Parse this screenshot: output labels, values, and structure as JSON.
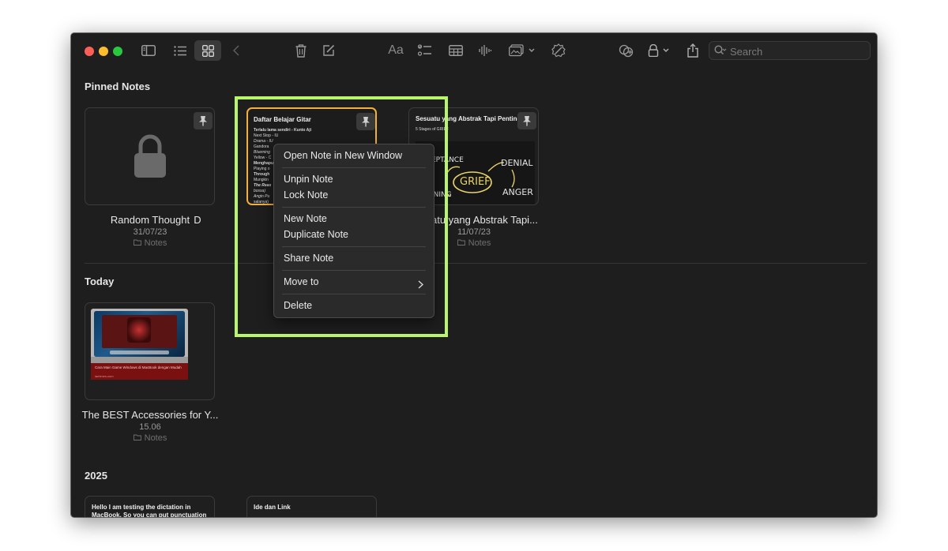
{
  "toolbar": {
    "search_placeholder": "Search",
    "icons": [
      "sidebar-icon",
      "list-view-icon",
      "gallery-view-icon",
      "back-icon",
      "trash-icon",
      "compose-icon",
      "format-icon",
      "checklist-icon",
      "table-icon",
      "audio-icon",
      "media-icon",
      "link-icon",
      "collaborate-icon",
      "lock-icon",
      "share-icon",
      "search-icon"
    ]
  },
  "sections": {
    "pinned": "Pinned Notes",
    "today": "Today",
    "year": "2025"
  },
  "notes": {
    "random": {
      "title": "Random Thought",
      "date": "31/07/23",
      "folder": "Notes"
    },
    "gitar": {
      "title": "Daftar Belajar Gitar",
      "list_title": "D",
      "lines": [
        "Terlalu lama sendiri - Kunto Aji",
        "Next Stop - IU",
        "Drama - IU",
        "Gandora",
        "Blueming",
        "Yellow - C",
        "Menghapu",
        "Playing o",
        "Through",
        "Mungkin",
        "The Reas",
        "bossa)",
        "Angin Pu",
        "salanya)"
      ]
    },
    "abstrak": {
      "title": "Sesuatu yang Abstrak Tapi Penting",
      "subtitle": "5 Stages of GRIEF",
      "list_title": "atu yang Abstrak Tapi...",
      "date": "11/07/23",
      "folder": "Notes",
      "board_words": [
        "EPTANCE",
        "DENIAL",
        "GRIEF",
        "ANGER",
        "INING"
      ]
    },
    "best": {
      "title": "The BEST Accessories for Y...",
      "date": "15.06",
      "folder": "Notes",
      "caption": "Cara Main Game Windows di MacBook dengan Mudah",
      "source": "iamimes.com"
    },
    "hello": {
      "text": "Hello I am testing the dictation in MacBook. So you can put punctuation"
    },
    "ide": {
      "title": "Ide dan Link"
    }
  },
  "context_menu": {
    "items": [
      "Open Note in New Window",
      "Unpin Note",
      "Lock Note",
      "New Note",
      "Duplicate Note",
      "Share Note",
      "Move to",
      "Delete"
    ]
  },
  "colors": {
    "window_bg": "#1e1e1e",
    "selected_border": "#f3b13a",
    "highlight": "#b8f56b",
    "close": "#fe5f57",
    "minimize": "#febc2e",
    "zoom": "#28c840"
  }
}
